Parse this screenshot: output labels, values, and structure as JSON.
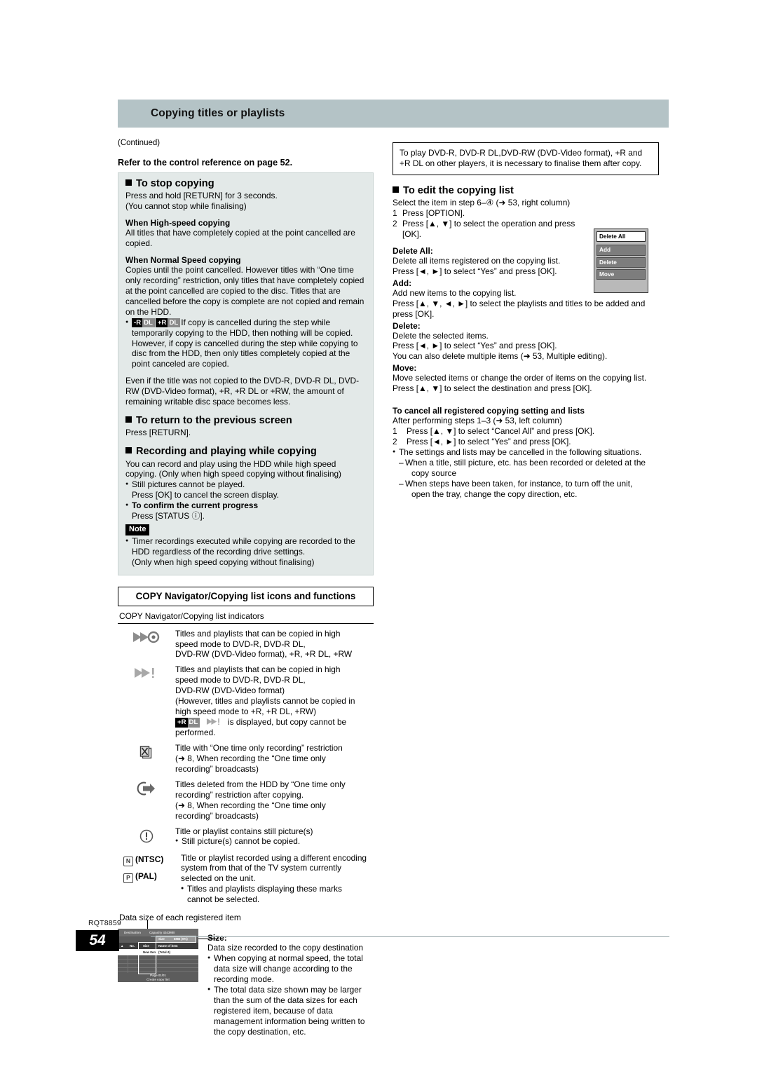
{
  "header": {
    "title": "Copying titles or playlists"
  },
  "left": {
    "continued": "(Continued)",
    "refer_line": "Refer to the control reference on page 52.",
    "stop": {
      "heading": "To stop copying",
      "line1": "Press and hold [RETURN] for 3 seconds.",
      "line2": "(You cannot stop while finalising)",
      "high_speed_head": "When High-speed copying",
      "high_speed_body": "All titles that have completely copied at the point cancelled are copied.",
      "normal_head": "When Normal Speed copying",
      "normal_body": "Copies until the point cancelled. However titles with “One time only recording” restriction, only titles that have completely copied at the point cancelled are copied to the disc. Titles that are cancelled before the copy is complete are not copied and remain on the HDD.",
      "badge1_a": "-R",
      "badge1_b": "DL",
      "badge2_a": "+R",
      "badge2_b": "DL",
      "dl_bullet": "If copy is cancelled during the step while temporarily copying to the HDD, then nothing will be copied. However, if copy is cancelled during the step while copying to disc from the HDD, then only titles completely copied at the point canceled are copied.",
      "even_if": "Even if the title was not copied to the DVD-R, DVD-R DL, DVD-RW (DVD-Video format), +R, +R DL or +RW, the amount of remaining writable disc space becomes less."
    },
    "return_screen": {
      "heading": "To return to the previous screen",
      "body": "Press [RETURN]."
    },
    "recording": {
      "heading": "Recording and playing while copying",
      "body": "You can record and play using the HDD while high speed copying. (Only when high speed copying without finalising)",
      "bullet1": "Still pictures cannot be played.",
      "bullet1_sub": "Press [OK] to cancel the screen display.",
      "bullet2": "To confirm the current progress",
      "bullet2_sub": "Press [STATUS ⓘ].",
      "note_tag": "Note",
      "note_bullet": "Timer recordings executed while copying are recorded to the HDD regardless of the recording drive settings.",
      "note_sub": "(Only when high speed copying without finalising)"
    },
    "icons_section": {
      "title": "COPY Navigator/Copying list icons and functions",
      "caption": "COPY Navigator/Copying list indicators",
      "rows": [
        {
          "icon": "fast-forward-disc-icon",
          "lines": [
            "Titles and playlists that can be copied in high",
            "speed mode to DVD-R, DVD-R DL,",
            "DVD-RW (DVD-Video format), +R, +R DL, +RW"
          ]
        },
        {
          "icon": "fast-forward-exclaim-icon",
          "lines": [
            "Titles and playlists that can be copied in high",
            "speed mode to DVD-R, DVD-R DL,",
            "DVD-RW (DVD-Video format)",
            "(However, titles and playlists cannot be copied in",
            "high speed mode to +R, +R DL, +RW)"
          ],
          "badge_a": "+R",
          "badge_b": "DL",
          "badge_tail": "is displayed, but copy cannot be performed."
        },
        {
          "icon": "one-time-only-icon",
          "lines": [
            "Title with “One time only recording” restriction",
            "(➜ 8, When recording the “One time only",
            "recording” broadcasts)"
          ]
        },
        {
          "icon": "moved-out-arrow-icon",
          "lines": [
            "Titles deleted from the HDD by “One time only",
            "recording” restriction after copying.",
            "(➜ 8, When recording the “One time only",
            "recording” broadcasts)"
          ]
        },
        {
          "icon": "exclamation-circle-icon",
          "lines": [
            "Title or playlist contains still picture(s)"
          ],
          "bullet": "Still picture(s) cannot be copied."
        }
      ],
      "ntsc_label": "(NTSC)",
      "ntsc_glyph": "N",
      "pal_label": "(PAL)",
      "pal_glyph": "P",
      "tv_system_lines": [
        "Title or playlist recorded using a different encoding",
        "system from that of the TV system currently",
        "selected on the unit."
      ],
      "tv_system_bullet": "Titles and playlists displaying these marks",
      "tv_system_bullet_cont": "cannot be selected."
    },
    "datasize": {
      "caption": "Data size of each registered item",
      "screen": {
        "destination": "Destination",
        "capacity": "Capacity  4343MB",
        "size_label": "Size",
        "size_value": "8MB (0%)",
        "col_no": "No.",
        "col_size": "Size",
        "col_name": "Name of item",
        "row_new": "New Item",
        "row_total": "(Total:4)",
        "page": "Page  01/01",
        "footer": "Create copy list"
      },
      "size_head": "Size:",
      "size_body": "Data size recorded to the copy destination",
      "bullet1": "When copying at normal speed, the total data size will change according to the recording mode.",
      "bullet2": "The total data size shown may be larger than the sum of the data sizes for each registered item, because of data management information being written to the copy destination, etc."
    }
  },
  "right": {
    "box_note": "To play DVD-R, DVD-R DL,DVD-RW (DVD-Video format), +R and +R DL on other players, it is necessary to finalise them after copy.",
    "edit": {
      "heading": "To edit the copying list",
      "select_line": "Select the item in step 6–④ (➜ 53, right column)",
      "step1_n": "1",
      "step1": "Press [OPTION].",
      "step2_n": "2",
      "step2": "Press [▲, ▼] to select the operation and press [OK].",
      "menu": {
        "selected": "Delete All",
        "items": [
          "Add",
          "Delete",
          "Move"
        ]
      },
      "delete_all_head": "Delete All:",
      "delete_all_l1": "Delete all items registered on the copying list.",
      "delete_all_l2": "Press [◄, ►] to select “Yes” and press [OK].",
      "add_head": "Add:",
      "add_l1": "Add new items to the copying list.",
      "add_l2": "Press [▲, ▼, ◄, ►] to select the playlists and titles to be added and press [OK].",
      "delete_head": "Delete:",
      "delete_l1": "Delete the selected items.",
      "delete_l2": "Press [◄, ►] to select “Yes” and press [OK].",
      "delete_l3": "You can also delete multiple items (➜ 53, Multiple editing).",
      "move_head": "Move:",
      "move_l1": "Move selected items or change the order of items on the copying list.",
      "move_l2": "Press [▲, ▼] to select the destination and press [OK]."
    },
    "cancel": {
      "heading": "To cancel all registered copying setting and lists",
      "after_line": "After performing steps 1–3 (➜ 53, left column)",
      "step1_n": "1",
      "step1": "Press [▲, ▼] to select “Cancel All” and press [OK].",
      "step2_n": "2",
      "step2": "Press [◄, ►] to select “Yes” and press [OK].",
      "bullet": "The settings and lists may be cancelled in the following situations.",
      "dash1": "When a title, still picture, etc. has been recorded or deleted at the",
      "dash1_cont": "copy source",
      "dash2": "When steps have been taken, for instance, to turn off the unit,",
      "dash2_cont": "open the tray, change the copy direction, etc."
    }
  },
  "footer": {
    "doc_code": "RQT8859",
    "page_number": "54"
  },
  "colors": {
    "header_bar": "#b4c3c6",
    "panel": "#e3e9e8",
    "footer_rule": "#9aa8ab"
  }
}
